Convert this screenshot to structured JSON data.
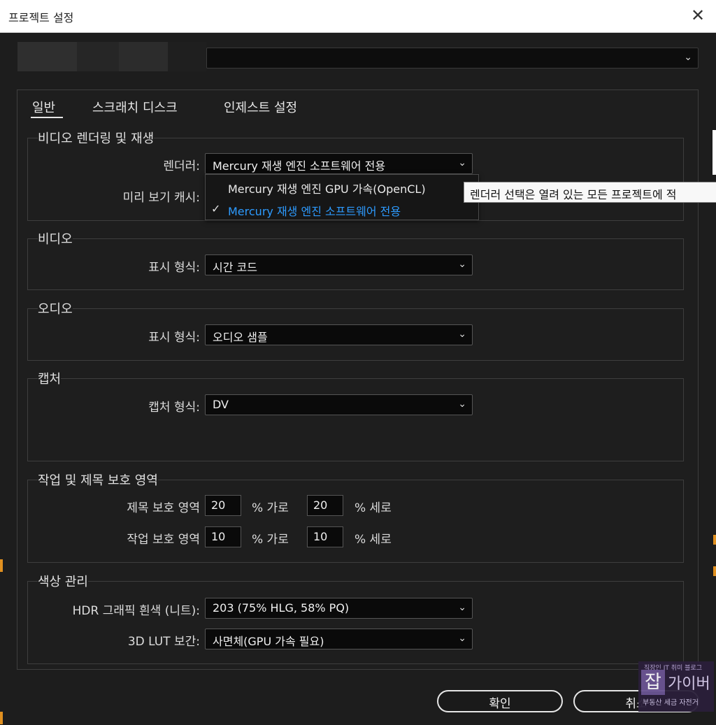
{
  "window": {
    "title": "프로젝트 설정"
  },
  "tabs": [
    {
      "label": "일반"
    },
    {
      "label": "스크래치 디스크"
    },
    {
      "label": "인제스트 설정"
    }
  ],
  "video_rendering": {
    "title": "비디오 렌더링 및 재생",
    "renderer_label": "렌더러:",
    "renderer_value": "Mercury 재생 엔진 소프트웨어 전용",
    "preview_cache_label": "미리 보기 캐시:",
    "dropdown_options": [
      "Mercury 재생 엔진 GPU 가속(OpenCL)",
      "Mercury 재생 엔진 소프트웨어 전용"
    ],
    "tooltip": "렌더러 선택은 열려 있는 모든 프로젝트에 적"
  },
  "video": {
    "title": "비디오",
    "display_format_label": "표시 형식:",
    "display_format_value": "시간 코드"
  },
  "audio": {
    "title": "오디오",
    "display_format_label": "표시 형식:",
    "display_format_value": "오디오 샘플"
  },
  "capture": {
    "title": "캡처",
    "format_label": "캡처 형식:",
    "format_value": "DV"
  },
  "safe_margins": {
    "title": "작업 및 제목 보호 영역",
    "title_safe_label": "제목 보호 영역",
    "title_safe_h": "20",
    "title_safe_v": "20",
    "action_safe_label": "작업 보호 영역",
    "action_safe_h": "10",
    "action_safe_v": "10",
    "unit_h": "% 가로",
    "unit_v": "% 세로"
  },
  "color": {
    "title": "색상 관리",
    "hdr_label": "HDR 그래픽 흰색 (니트):",
    "hdr_value": "203 (75% HLG, 58% PQ)",
    "lut_label": "3D LUT 보간:",
    "lut_value": "사면체(GPU 가속 필요)"
  },
  "buttons": {
    "ok": "확인",
    "cancel": "취소"
  },
  "watermark": {
    "small": "직장인 IT 취미 블로그",
    "big": "잡",
    "name": "가이버",
    "sub": "부동산 세금 자전거"
  },
  "colors": {
    "accent_selected": "#2d9bff",
    "background": "#1e1e1e"
  }
}
